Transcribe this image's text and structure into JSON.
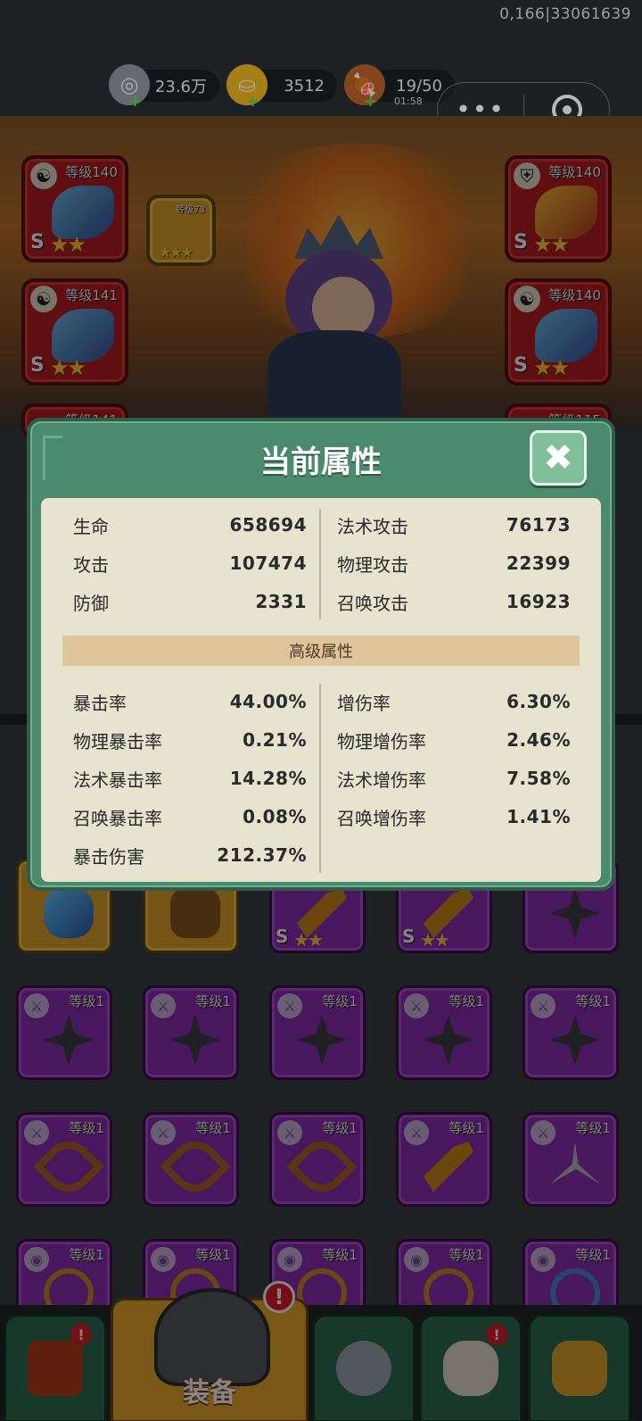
{
  "debug_text": "0,166|33061639",
  "resources": [
    {
      "icon": "silver-coin-icon",
      "value": "23.6万"
    },
    {
      "icon": "gold-ingot-icon",
      "value": "3512"
    },
    {
      "icon": "meat-stamina-icon",
      "value": "19/50",
      "timer": "01:58"
    }
  ],
  "capsule": {
    "more": "•••"
  },
  "equipped_left": [
    {
      "level": "等级140",
      "grade": "S",
      "stars": "★★"
    },
    {
      "level": "等级141",
      "grade": "S",
      "stars": "★★"
    },
    {
      "level": "等级141",
      "grade": "",
      "stars": ""
    }
  ],
  "equipped_right": [
    {
      "level": "等级140",
      "grade": "S",
      "stars": "★★"
    },
    {
      "level": "等级140",
      "grade": "S",
      "stars": "★★"
    },
    {
      "level": "等级115",
      "grade": "",
      "stars": ""
    }
  ],
  "linked_item": {
    "level": "等级73",
    "stars": "★★★"
  },
  "popup": {
    "title": "当前属性",
    "close": "✖",
    "basic": [
      {
        "label": "生命",
        "value": "658694"
      },
      {
        "label": "攻击",
        "value": "107474"
      },
      {
        "label": "防御",
        "value": "2331"
      },
      {
        "label": "法术攻击",
        "value": "76173"
      },
      {
        "label": "物理攻击",
        "value": "22399"
      },
      {
        "label": "召唤攻击",
        "value": "16923"
      }
    ],
    "advanced_header": "高级属性",
    "advanced_left": [
      {
        "label": "暴击率",
        "value": "44.00%"
      },
      {
        "label": "物理暴击率",
        "value": "0.21%"
      },
      {
        "label": "法术暴击率",
        "value": "14.28%"
      },
      {
        "label": "召唤暴击率",
        "value": "0.08%"
      },
      {
        "label": "暴击伤害",
        "value": "212.37%"
      }
    ],
    "advanced_right": [
      {
        "label": "增伤率",
        "value": "6.30%"
      },
      {
        "label": "物理增伤率",
        "value": "2.46%"
      },
      {
        "label": "法术增伤率",
        "value": "7.58%"
      },
      {
        "label": "召唤增伤率",
        "value": "1.41%"
      }
    ]
  },
  "inventory_top": [
    {
      "grade": "",
      "stars": ""
    },
    {
      "grade": "",
      "stars": ""
    },
    {
      "grade": "S",
      "stars": "★★"
    },
    {
      "grade": "S",
      "stars": "★★"
    },
    {
      "grade": "",
      "stars": ""
    }
  ],
  "inventory_rows": [
    [
      {
        "level": "等级1"
      },
      {
        "level": "等级1"
      },
      {
        "level": "等级1"
      },
      {
        "level": "等级1"
      },
      {
        "level": "等级1"
      }
    ],
    [
      {
        "level": "等级1"
      },
      {
        "level": "等级1"
      },
      {
        "level": "等级1"
      },
      {
        "level": "等级1"
      },
      {
        "level": "等级1"
      }
    ],
    [
      {
        "level": "等级1"
      },
      {
        "level": "等级1"
      },
      {
        "level": "等级1"
      },
      {
        "level": "等级1"
      },
      {
        "level": "等级1"
      }
    ]
  ],
  "nav": {
    "active_label": "装备",
    "alert": "!"
  }
}
